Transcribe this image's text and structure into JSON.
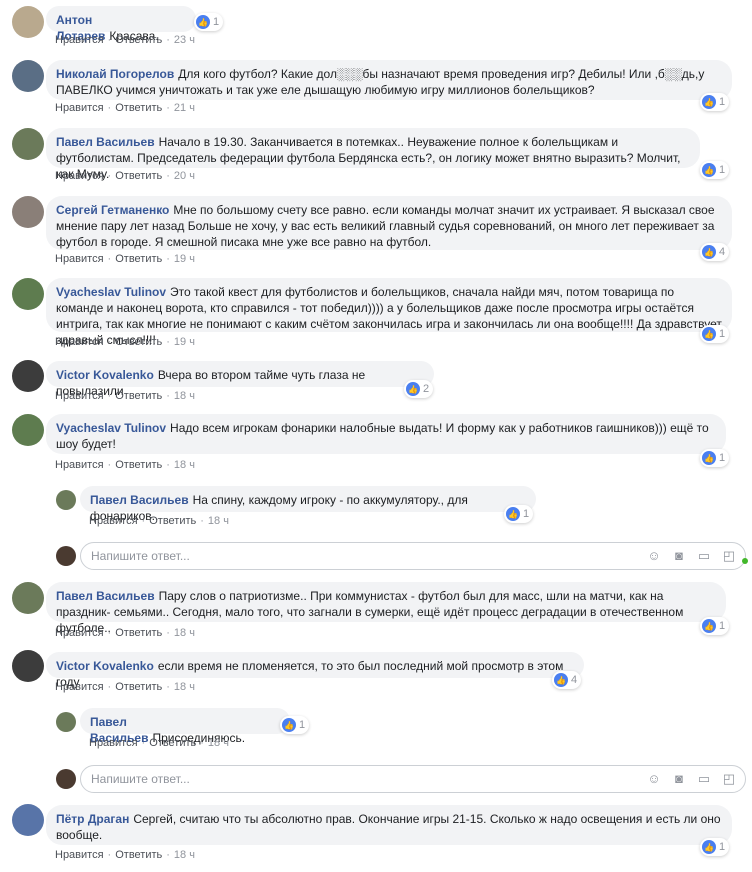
{
  "actions": {
    "like": "Нравится",
    "reply": "Ответить",
    "sep": "·"
  },
  "reply_placeholder": "Напишите ответ...",
  "comments": [
    {
      "author": "Антон Лотарев",
      "text": "Красава.",
      "time": "23 ч",
      "likes": "1"
    },
    {
      "author": "Николай Погорелов",
      "text": "Для кого футбол? Какие дол░░░бы назначают время проведения игр? Дебилы! Или ,б░░дь,у ПАВЕЛКО учимся уничтожать и так уже еле дышащую любимую игру миллионов болельщиков?",
      "time": "21 ч",
      "likes": "1"
    },
    {
      "author": "Павел Васильев",
      "text": "Начало в 19.30. Заканчивается в потемках.. Неуважение полное к болельщикам и футболистам. Председатель федерации футбола Бердянска есть?, он логику может внятно выразить? Молчит, как Муму.",
      "time": "20 ч",
      "likes": "1"
    },
    {
      "author": "Сергей Гетманенко",
      "text": "Мне по большому счету все равно. если команды молчат значит их устраивает. Я высказал свое мнение пару лет назад Больше не хочу, у вас есть великий главный судья соревнований, он много лет переживает за футбол в городе. Я смешной писака мне уже все равно на футбол.",
      "time": "19 ч",
      "likes": "4"
    },
    {
      "author": "Vyacheslav Tulinov",
      "text": "Это такой квест для футболистов и болельщиков, сначала найди мяч, потом товарища по команде и наконец ворота, кто справился - тот победил)))) а у болельщиков даже после просмотра игры остаётся интрига, так как многие не понимают с каким счётом закончилась игра и закончилась ли она вообще!!!! Да здравствует здравый смысл!!!!",
      "time": "19 ч",
      "likes": "1"
    },
    {
      "author": "Victor Kovalenko",
      "text": "Вчера во втором тайме чуть глаза не повылазили",
      "time": "18 ч",
      "likes": "2"
    },
    {
      "author": "Vyacheslav Tulinov",
      "text": "Надо всем игрокам фонарики налобные выдать! И форму как у работников гаишников))) ещё то шоу будет!",
      "time": "18 ч",
      "likes": "1"
    },
    {
      "author": "Павел Васильев",
      "text": "На спину, каждому игроку - по аккумулятору., для фонариков..",
      "time": "18 ч",
      "likes": "1"
    },
    {
      "author": "Павел Васильев",
      "text": "Пару слов о патриотизме.. При коммунистах - футбол был для масс, шли на матчи, как на праздник- семьями.. Сегодня, мало того, что загнали в сумерки, ещё идёт процесс деградации в отечественном футболе..",
      "time": "18 ч",
      "likes": "1"
    },
    {
      "author": "Victor Kovalenko",
      "text": "если время не пломеняется, то это был последний мой просмотр в этом году",
      "time": "18 ч",
      "likes": "4"
    },
    {
      "author": "Павел Васильев",
      "text": "Присоединяюсь.",
      "time": "18 ч",
      "likes": "1"
    },
    {
      "author": "Пётр Драган",
      "text": "Сергей, считаю что ты абсолютно прав. Окончание игры 21-15. Сколько ж надо освещения и есть ли оно вообще.",
      "time": "18 ч",
      "likes": "1"
    }
  ],
  "colors": {
    "author": "#385898",
    "bubble": "#f2f3f5",
    "like": "#4a7ff0"
  },
  "icons": [
    "like-icon",
    "emoji-icon",
    "camera-icon",
    "gif-icon",
    "sticker-icon"
  ]
}
